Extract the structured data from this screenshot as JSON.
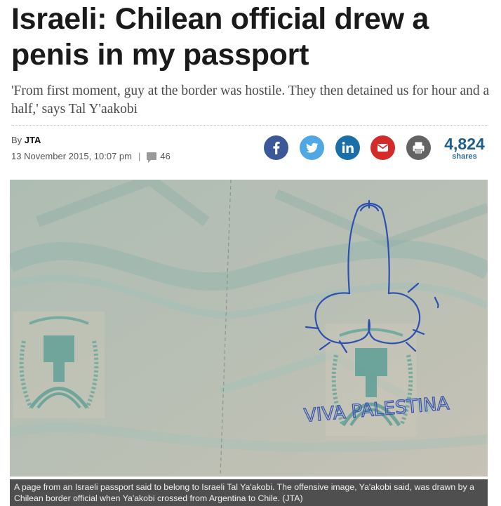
{
  "article": {
    "headline": "Israeli: Chilean official drew a penis in my passport",
    "subheadline": "'From first moment, guy at the border was hostile. They then detained us for hour and a half,' says Tal Y'aakobi",
    "byline_prefix": "By",
    "author": "JTA",
    "date": "13 November 2015, 10:07 pm",
    "separator": "|",
    "comment_count": "46"
  },
  "share": {
    "buttons": [
      {
        "name": "facebook",
        "icon": "facebook-icon",
        "color": "#3b5998"
      },
      {
        "name": "twitter",
        "icon": "twitter-icon",
        "color": "#4fa8e3"
      },
      {
        "name": "linkedin",
        "icon": "linkedin-icon",
        "color": "#1a6fa8"
      },
      {
        "name": "email",
        "icon": "mail-icon",
        "color": "#d32a2a"
      },
      {
        "name": "print",
        "icon": "printer-icon",
        "color": "#636363"
      }
    ],
    "count": "4,824",
    "count_label": "shares"
  },
  "photo": {
    "handwriting": "VIVA PALESTINA",
    "caption": "A page from an Israeli passport said to belong to Israeli Tal Ya'akobi. The offensive image, Ya'akobi said, was drawn by a Chilean border official when Ya'akobi crossed from Argentina to Chile. (JTA)"
  }
}
